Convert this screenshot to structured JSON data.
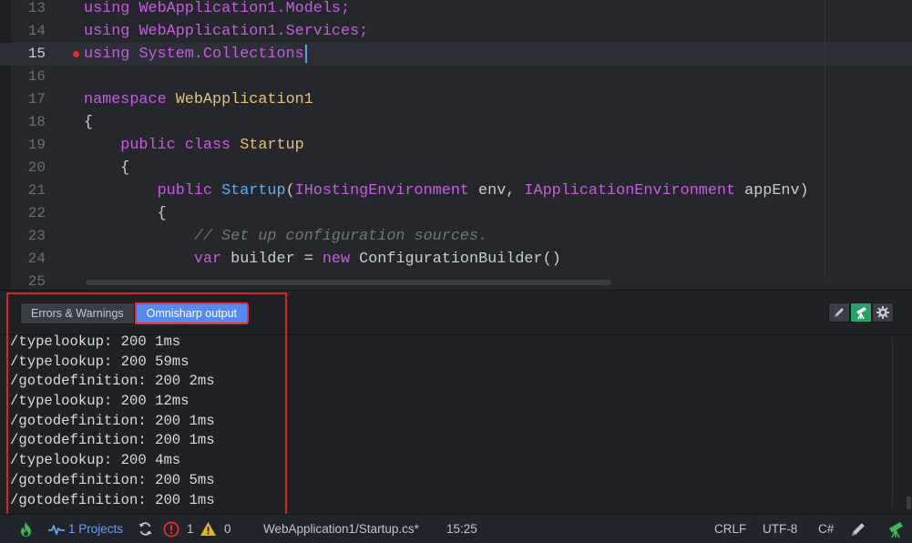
{
  "editor": {
    "lines": [
      {
        "number": "13",
        "tokens": [
          {
            "t": "using ",
            "c": "kw"
          },
          {
            "t": "WebApplication1.Models;",
            "c": "kw"
          }
        ]
      },
      {
        "number": "14",
        "tokens": [
          {
            "t": "using ",
            "c": "kw"
          },
          {
            "t": "WebApplication1.Services;",
            "c": "kw"
          }
        ]
      },
      {
        "number": "15",
        "active": true,
        "breakpoint": true,
        "cursor": true,
        "tokens": [
          {
            "t": "using ",
            "c": "kw"
          },
          {
            "t": "System.Collections",
            "c": "kw"
          }
        ]
      },
      {
        "number": "16",
        "tokens": []
      },
      {
        "number": "17",
        "tokens": [
          {
            "t": "namespace ",
            "c": "kw"
          },
          {
            "t": "WebApplication1",
            "c": "ty"
          }
        ]
      },
      {
        "number": "18",
        "tokens": [
          {
            "t": "{",
            "c": "tx"
          }
        ]
      },
      {
        "number": "19",
        "tokens": [
          {
            "t": "    public class ",
            "c": "kw"
          },
          {
            "t": "Startup",
            "c": "ty"
          }
        ]
      },
      {
        "number": "20",
        "tokens": [
          {
            "t": "    {",
            "c": "tx"
          }
        ]
      },
      {
        "number": "21",
        "tokens": [
          {
            "t": "        public ",
            "c": "kw"
          },
          {
            "t": "Startup",
            "c": "fn"
          },
          {
            "t": "(",
            "c": "tx"
          },
          {
            "t": "IHostingEnvironment",
            "c": "kw"
          },
          {
            "t": " env, ",
            "c": "tx"
          },
          {
            "t": "IApplicationEnvironment",
            "c": "kw"
          },
          {
            "t": " appEnv)",
            "c": "tx"
          }
        ]
      },
      {
        "number": "22",
        "tokens": [
          {
            "t": "        {",
            "c": "tx"
          }
        ]
      },
      {
        "number": "23",
        "tokens": [
          {
            "t": "            // Set up configuration sources.",
            "c": "cm"
          }
        ]
      },
      {
        "number": "24",
        "tokens": [
          {
            "t": "            var ",
            "c": "kw"
          },
          {
            "t": "builder = ",
            "c": "tx"
          },
          {
            "t": "new ",
            "c": "kw"
          },
          {
            "t": "ConfigurationBuilder()",
            "c": "tx"
          }
        ]
      },
      {
        "number": "25",
        "tokens": []
      }
    ]
  },
  "panel": {
    "tabs": [
      {
        "label": "Errors & Warnings",
        "selected": false
      },
      {
        "label": "Omnisharp output",
        "selected": true
      }
    ],
    "tools": [
      {
        "icon": "pencil-icon"
      },
      {
        "icon": "telescope-icon",
        "active": true
      },
      {
        "icon": "gear-icon"
      }
    ],
    "output": [
      "/typelookup: 200 1ms",
      "/typelookup: 200 59ms",
      "/gotodefinition: 200 2ms",
      "/typelookup: 200 12ms",
      "/gotodefinition: 200 1ms",
      "/gotodefinition: 200 1ms",
      "/typelookup: 200 4ms",
      "/gotodefinition: 200 5ms",
      "/gotodefinition: 200 1ms"
    ]
  },
  "status": {
    "flame_icon": "flame-icon",
    "projects_label": "1 Projects",
    "errors_count": "1",
    "warnings_count": "0",
    "file_path": "WebApplication1/Startup.cs*",
    "cursor_position": "15:25",
    "line_ending": "CRLF",
    "encoding": "UTF-8",
    "grammar": "C#"
  },
  "colors": {
    "keyword": "#c25fdb",
    "type": "#e5c07b",
    "function": "#61afef",
    "comment": "#6f7580",
    "accent": "#568af2",
    "highlight": "#d8232a"
  }
}
